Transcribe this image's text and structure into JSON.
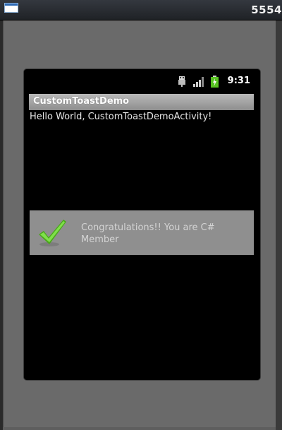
{
  "window": {
    "title": "5554"
  },
  "status_bar": {
    "time": "9:31"
  },
  "app": {
    "title": "CustomToastDemo",
    "hello_text": "Hello World, CustomToastDemoActivity!"
  },
  "toast": {
    "message": "Congratulations!! You are C# Member",
    "icon": "checkmark-icon",
    "accent_color": "#58c322"
  }
}
